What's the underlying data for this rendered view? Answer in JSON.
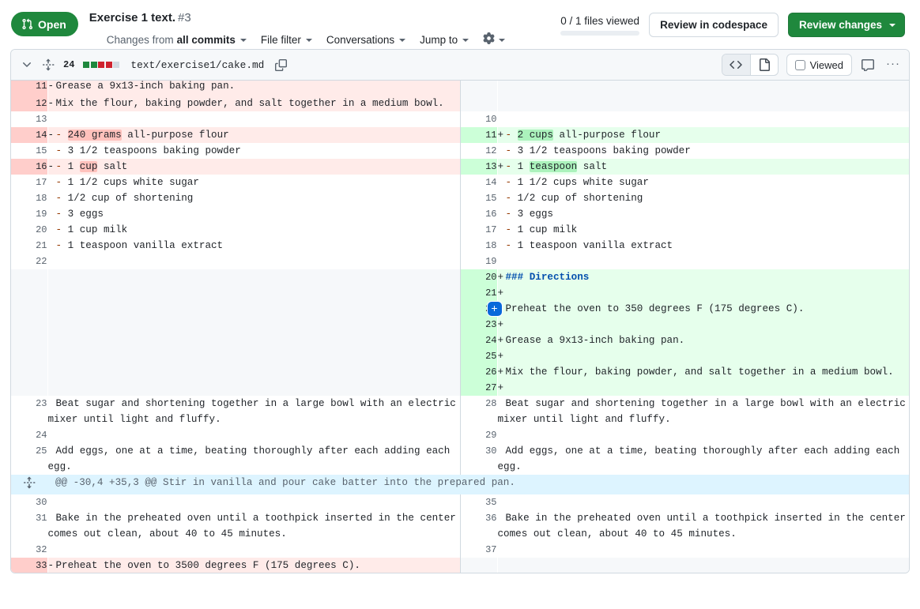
{
  "header": {
    "state_badge": {
      "label": "Open",
      "icon": "git-pull-request-icon",
      "color": "#1f883d"
    },
    "title": "Exercise 1 text.",
    "number": "#3",
    "subnav": [
      {
        "name": "changes-from",
        "prefix": "Changes from",
        "strong": "all commits",
        "caret": true
      },
      {
        "name": "file-filter",
        "label": "File filter",
        "caret": true
      },
      {
        "name": "conversations",
        "label": "Conversations",
        "caret": true
      },
      {
        "name": "jump-to",
        "label": "Jump to",
        "caret": true
      },
      {
        "name": "settings-gear",
        "label": "",
        "icon": "gear-icon",
        "caret": true
      }
    ],
    "files_viewed": "0 / 1 files viewed",
    "files_viewed_progress_pct": 0,
    "review_codespace_label": "Review in codespace",
    "review_changes_label": "Review changes"
  },
  "file": {
    "collapse_icon": "chevron-down-icon",
    "expand_icon": "unfold-icon",
    "change_count": "24",
    "diffstat": [
      "#1f883d",
      "#1f883d",
      "#cf222e",
      "#cf222e",
      "#d1d9e0"
    ],
    "path": "text/exercise1/cake.md",
    "copy_icon": "copy-icon",
    "view_code_icon": "code-icon",
    "view_file_icon": "file-icon",
    "viewed_label": "Viewed",
    "comment_icon": "comment-icon",
    "kebab_label": "···"
  },
  "diff": {
    "rows": [
      {
        "type": "del",
        "clipped": true,
        "left_num": "11",
        "left_marker": "-",
        "left_text": "Grease a 9x13-inch baking pan.",
        "right_num": "",
        "right_marker": "",
        "right_text": "",
        "right_type": "blank"
      },
      {
        "type": "del",
        "left_num": "12",
        "left_marker": "-",
        "left_text": "Mix the flour, baking powder, and salt together in a medium bowl.",
        "right_num": "",
        "right_marker": "",
        "right_text": "",
        "right_type": "blank"
      },
      {
        "type": "ctx",
        "left_num": "13",
        "left_marker": "",
        "left_text": "",
        "right_num": "10",
        "right_marker": "",
        "right_text": ""
      },
      {
        "type": "del",
        "right_type": "add",
        "left_num": "14",
        "left_marker": "-",
        "left_text": "- 240 grams all-purpose flour",
        "left_hl": "240 grams",
        "left_dash": true,
        "right_num": "11",
        "right_marker": "+",
        "right_text": "- 2 cups all-purpose flour",
        "right_hl": "2 cups",
        "right_dash": true
      },
      {
        "type": "ctx",
        "left_num": "15",
        "left_marker": "",
        "left_text": "- 3 1/2 teaspoons baking powder",
        "left_dash": true,
        "right_num": "12",
        "right_marker": "",
        "right_text": "- 3 1/2 teaspoons baking powder",
        "right_dash": true
      },
      {
        "type": "del",
        "right_type": "add",
        "left_num": "16",
        "left_marker": "-",
        "left_text": "- 1 cup salt",
        "left_hl": "cup",
        "left_dash": true,
        "right_num": "13",
        "right_marker": "+",
        "right_text": "- 1 teaspoon salt",
        "right_hl": "teaspoon",
        "right_dash": true
      },
      {
        "type": "ctx",
        "left_num": "17",
        "left_marker": "",
        "left_text": "- 1 1/2 cups white sugar",
        "left_dash": true,
        "right_num": "14",
        "right_marker": "",
        "right_text": "- 1 1/2 cups white sugar",
        "right_dash": true
      },
      {
        "type": "ctx",
        "left_num": "18",
        "left_marker": "",
        "left_text": "- 1/2 cup of shortening",
        "left_dash": true,
        "right_num": "15",
        "right_marker": "",
        "right_text": "- 1/2 cup of shortening",
        "right_dash": true
      },
      {
        "type": "ctx",
        "left_num": "19",
        "left_marker": "",
        "left_text": "- 3 eggs",
        "left_dash": true,
        "right_num": "16",
        "right_marker": "",
        "right_text": "- 3 eggs",
        "right_dash": true
      },
      {
        "type": "ctx",
        "left_num": "20",
        "left_marker": "",
        "left_text": "- 1 cup milk",
        "left_dash": true,
        "right_num": "17",
        "right_marker": "",
        "right_text": "- 1 cup milk",
        "right_dash": true
      },
      {
        "type": "ctx",
        "left_num": "21",
        "left_marker": "",
        "left_text": "- 1 teaspoon vanilla extract",
        "left_dash": true,
        "right_num": "18",
        "right_marker": "",
        "right_text": "- 1 teaspoon vanilla extract",
        "right_dash": true
      },
      {
        "type": "ctx",
        "left_num": "22",
        "left_marker": "",
        "left_text": "",
        "right_num": "19",
        "right_marker": "",
        "right_text": ""
      },
      {
        "type": "blank",
        "right_type": "add",
        "left_num": "",
        "left_marker": "",
        "left_text": "",
        "right_num": "20",
        "right_marker": "+",
        "right_text": "### Directions",
        "right_heading": true
      },
      {
        "type": "blank",
        "right_type": "add",
        "left_num": "",
        "left_marker": "",
        "left_text": "",
        "right_num": "21",
        "right_marker": "+",
        "right_text": ""
      },
      {
        "type": "blank",
        "right_type": "add",
        "right_comment_button": "+",
        "left_num": "",
        "left_marker": "",
        "left_text": "",
        "right_num": "22",
        "right_marker": "",
        "right_text": "Preheat the oven to 350 degrees F (175 degrees C)."
      },
      {
        "type": "blank",
        "right_type": "add",
        "left_num": "",
        "left_marker": "",
        "left_text": "",
        "right_num": "23",
        "right_marker": "+",
        "right_text": ""
      },
      {
        "type": "blank",
        "right_type": "add",
        "left_num": "",
        "left_marker": "",
        "left_text": "",
        "right_num": "24",
        "right_marker": "+",
        "right_text": "Grease a 9x13-inch baking pan."
      },
      {
        "type": "blank",
        "right_type": "add",
        "left_num": "",
        "left_marker": "",
        "left_text": "",
        "right_num": "25",
        "right_marker": "+",
        "right_text": ""
      },
      {
        "type": "blank",
        "right_type": "add",
        "left_num": "",
        "left_marker": "",
        "left_text": "",
        "right_num": "26",
        "right_marker": "+",
        "right_text": "Mix the flour, baking powder, and salt together in a medium bowl."
      },
      {
        "type": "blank",
        "right_type": "add",
        "left_num": "",
        "left_marker": "",
        "left_text": "",
        "right_num": "27",
        "right_marker": "+",
        "right_text": ""
      },
      {
        "type": "ctx",
        "left_num": "23",
        "left_marker": "",
        "left_text": "Beat sugar and shortening together in a large bowl with an electric mixer until light and fluffy.",
        "right_num": "28",
        "right_marker": "",
        "right_text": "Beat sugar and shortening together in a large bowl with an electric mixer until light and fluffy."
      },
      {
        "type": "ctx",
        "left_num": "24",
        "left_marker": "",
        "left_text": "",
        "right_num": "29",
        "right_marker": "",
        "right_text": ""
      },
      {
        "type": "ctx",
        "left_num": "25",
        "left_marker": "",
        "left_text": "Add eggs, one at a time, beating thoroughly after each adding each egg.",
        "right_num": "30",
        "right_marker": "",
        "right_text": "Add eggs, one at a time, beating thoroughly after each adding each egg."
      },
      {
        "type": "hunk",
        "hunk_text": "@@ -30,4 +35,3 @@ Stir in vanilla and pour cake batter into the prepared pan."
      },
      {
        "type": "ctx",
        "left_num": "30",
        "left_marker": "",
        "left_text": "",
        "right_num": "35",
        "right_marker": "",
        "right_text": ""
      },
      {
        "type": "ctx",
        "left_num": "31",
        "left_marker": "",
        "left_text": "Bake in the preheated oven until a toothpick inserted in the center comes out clean, about 40 to 45 minutes.",
        "right_num": "36",
        "right_marker": "",
        "right_text": "Bake in the preheated oven until a toothpick inserted in the center comes out clean, about 40 to 45 minutes."
      },
      {
        "type": "ctx",
        "left_num": "32",
        "left_marker": "",
        "left_text": "",
        "right_num": "37",
        "right_marker": "",
        "right_text": ""
      },
      {
        "type": "del",
        "left_num": "33",
        "left_marker": "-",
        "left_text": "Preheat the oven to 3500 degrees F (175 degrees C).",
        "right_num": "",
        "right_marker": "",
        "right_text": "",
        "right_type": "blank"
      }
    ]
  }
}
